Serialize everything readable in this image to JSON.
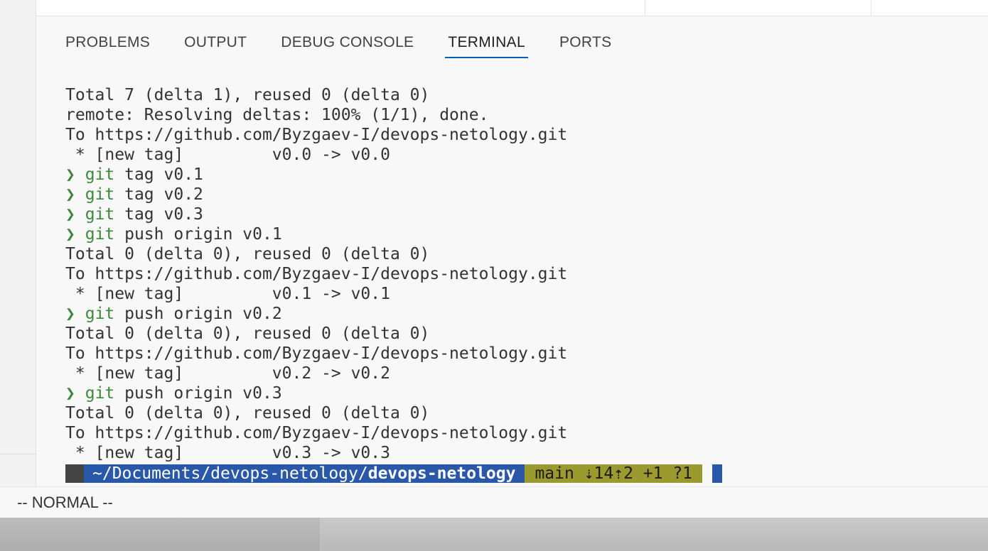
{
  "panel": {
    "tabs": [
      {
        "label": "PROBLEMS"
      },
      {
        "label": "OUTPUT"
      },
      {
        "label": "DEBUG CONSOLE"
      },
      {
        "label": "TERMINAL"
      },
      {
        "label": "PORTS"
      }
    ],
    "active_tab": "TERMINAL"
  },
  "terminal": {
    "lines": [
      "Total 7 (delta 1), reused 0 (delta 0)",
      "remote: Resolving deltas: 100% (1/1), done.",
      "To https://github.com/Byzgaev-I/devops-netology.git",
      " * [new tag]         v0.0 -> v0.0",
      {
        "arrow": "❯",
        "cmd": "git",
        "args": " tag v0.1"
      },
      {
        "arrow": "❯",
        "cmd": "git",
        "args": " tag v0.2"
      },
      {
        "arrow": "❯",
        "cmd": "git",
        "args": " tag v0.3"
      },
      {
        "arrow": "❯",
        "cmd": "git",
        "args": " push origin v0.1"
      },
      "Total 0 (delta 0), reused 0 (delta 0)",
      "To https://github.com/Byzgaev-I/devops-netology.git",
      " * [new tag]         v0.1 -> v0.1",
      {
        "arrow": "❯",
        "cmd": "git",
        "args": " push origin v0.2"
      },
      "Total 0 (delta 0), reused 0 (delta 0)",
      "To https://github.com/Byzgaev-I/devops-netology.git",
      " * [new tag]         v0.2 -> v0.2",
      {
        "arrow": "❯",
        "cmd": "git",
        "args": " push origin v0.3"
      },
      "Total 0 (delta 0), reused 0 (delta 0)",
      "To https://github.com/Byzgaev-I/devops-netology.git",
      " * [new tag]         v0.3 -> v0.3"
    ],
    "prompt": {
      "os_glyph": "",
      "folder_glyph": "",
      "path_prefix": " ~/Documents/devops-netology/",
      "path_current": "devops-netology",
      "git_glyphs": " ",
      "branch": "main",
      "status": "⇣14⇡2 +1 ?1"
    },
    "colors": {
      "prompt_green": "#3a8a3a",
      "os_segment": "#444444",
      "path_segment": "#2a58a8",
      "git_segment": "#9b9a2e"
    }
  },
  "mode_bar": {
    "mode": "-- NORMAL --"
  }
}
